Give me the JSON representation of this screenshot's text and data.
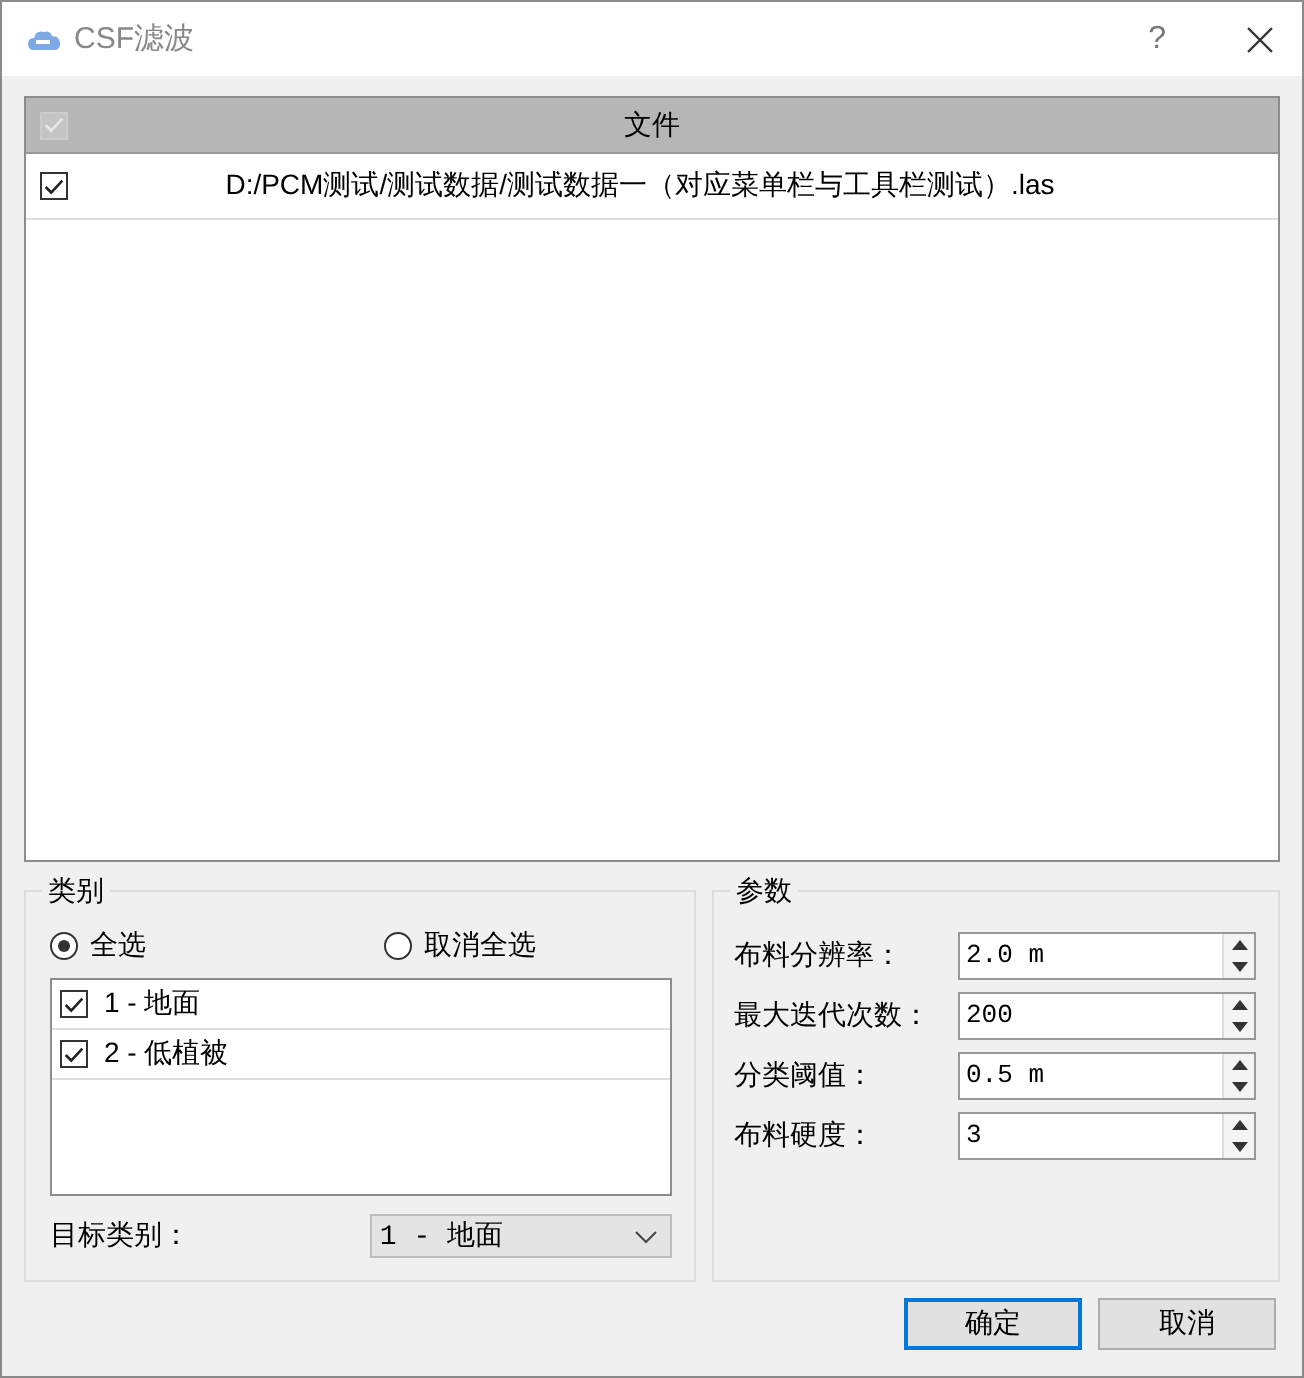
{
  "window": {
    "title": "CSF滤波",
    "help": "?"
  },
  "file_table": {
    "header_checked": true,
    "columns": [
      "文件"
    ],
    "rows": [
      {
        "checked": true,
        "path": "D:/PCM测试/测试数据/测试数据一（对应菜单栏与工具栏测试）.las"
      }
    ]
  },
  "category_group": {
    "title": "类别",
    "radios": [
      {
        "label": "全选",
        "selected": true
      },
      {
        "label": "取消全选",
        "selected": false
      }
    ],
    "items": [
      {
        "label": "1 - 地面",
        "checked": true
      },
      {
        "label": "2 - 低植被",
        "checked": true
      }
    ],
    "target_label": "目标类别：",
    "target_value": "1 - 地面"
  },
  "params_group": {
    "title": "参数",
    "fields": [
      {
        "label": "布料分辨率：",
        "value": "2.0 m"
      },
      {
        "label": "最大迭代次数：",
        "value": "200"
      },
      {
        "label": "分类阈值：",
        "value": "0.5 m"
      },
      {
        "label": "布料硬度：",
        "value": "3"
      }
    ]
  },
  "buttons": [
    {
      "label": "确定",
      "focused": true
    },
    {
      "label": "取消",
      "focused": false
    }
  ]
}
